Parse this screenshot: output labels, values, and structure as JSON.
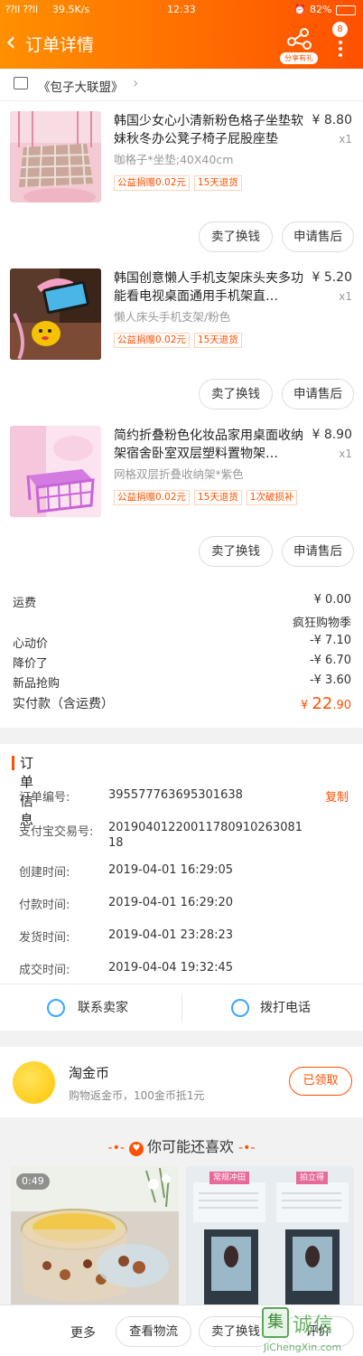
{
  "status_bar": {
    "signal": "⁇ll ⁇ll",
    "speed": "39.5K/s",
    "time": "12:33",
    "battery": "82%"
  },
  "header": {
    "back_icon": "‹",
    "title": "订单详情",
    "share_label": "分享有礼",
    "notification_count": "8"
  },
  "shop": {
    "name": "《包子大联盟》",
    "arrow": "›"
  },
  "products": [
    {
      "title": "韩国少女心小清新粉色格子坐垫软妹秋冬办公凳子椅子屁股座垫",
      "price": "¥ 8.80",
      "qty": "x1",
      "sku": "咖格子*坐垫;40X40cm",
      "tags": [
        "公益捐赠0.02元",
        "15天退货"
      ],
      "btn1": "卖了换钱",
      "btn2": "申请售后"
    },
    {
      "title": "韩国创意懒人手机支架床头夹多功能看电视桌面通用手机架直…",
      "price": "¥ 5.20",
      "qty": "x1",
      "sku": "懒人床头手机支架/粉色",
      "tags": [
        "公益捐赠0.02元",
        "15天退货"
      ],
      "btn1": "卖了换钱",
      "btn2": "申请售后"
    },
    {
      "title": "简约折叠粉色化妆品家用桌面收纳架宿舍卧室双层塑料置物架…",
      "price": "¥ 8.90",
      "qty": "x1",
      "sku": "网格双层折叠收纳架*紫色",
      "tags": [
        "公益捐赠0.02元",
        "15天退货",
        "1次破损补"
      ],
      "btn1": "卖了换钱",
      "btn2": "申请售后"
    }
  ],
  "summary": {
    "shipping_label": "运费",
    "shipping_value": "¥ 0.00",
    "promo_name": "疯狂购物季",
    "d1_label": "心动价",
    "d1_value": "-¥ 7.10",
    "d2_label": "降价了",
    "d2_value": "-¥ 6.70",
    "d3_label": "新品抢购",
    "d3_value": "-¥ 3.60",
    "total_label": "实付款（含运费）",
    "total_currency": "¥ ",
    "total_int": "22",
    "total_dec": ".90"
  },
  "order_info": {
    "header": "订单信息",
    "rows": [
      {
        "label": "订单编号:",
        "value": "395577763695301638"
      },
      {
        "label": "支付宝交易号:",
        "value": "2019040122001178091026308118"
      },
      {
        "label": "创建时间:",
        "value": "2019-04-01 16:29:05"
      },
      {
        "label": "付款时间:",
        "value": "2019-04-01 16:29:20"
      },
      {
        "label": "发货时间:",
        "value": "2019-04-01 23:28:23"
      },
      {
        "label": "成交时间:",
        "value": "2019-04-04 19:32:45"
      }
    ],
    "copy_label": "复制"
  },
  "contact": {
    "seller": "联系卖家",
    "call": "拨打电话"
  },
  "coins": {
    "title": "淘金币",
    "subtitle": "购物返金币，100金币抵1元",
    "button": "已领取"
  },
  "recommend": {
    "title": "你可能还喜欢",
    "dash": "-•-",
    "card1_badge": "0:49",
    "card2_tag1": "常规冲田",
    "card2_tag2": "拍立得"
  },
  "bottom": {
    "more": "更多",
    "logistics": "查看物流",
    "sell": "卖了换钱",
    "review": "评价"
  },
  "watermark": {
    "char": "集",
    "text": "诚信",
    "url": "JiChengXin.com"
  },
  "colors": {
    "accent": "#ff5000",
    "header_start": "#ff9000"
  }
}
